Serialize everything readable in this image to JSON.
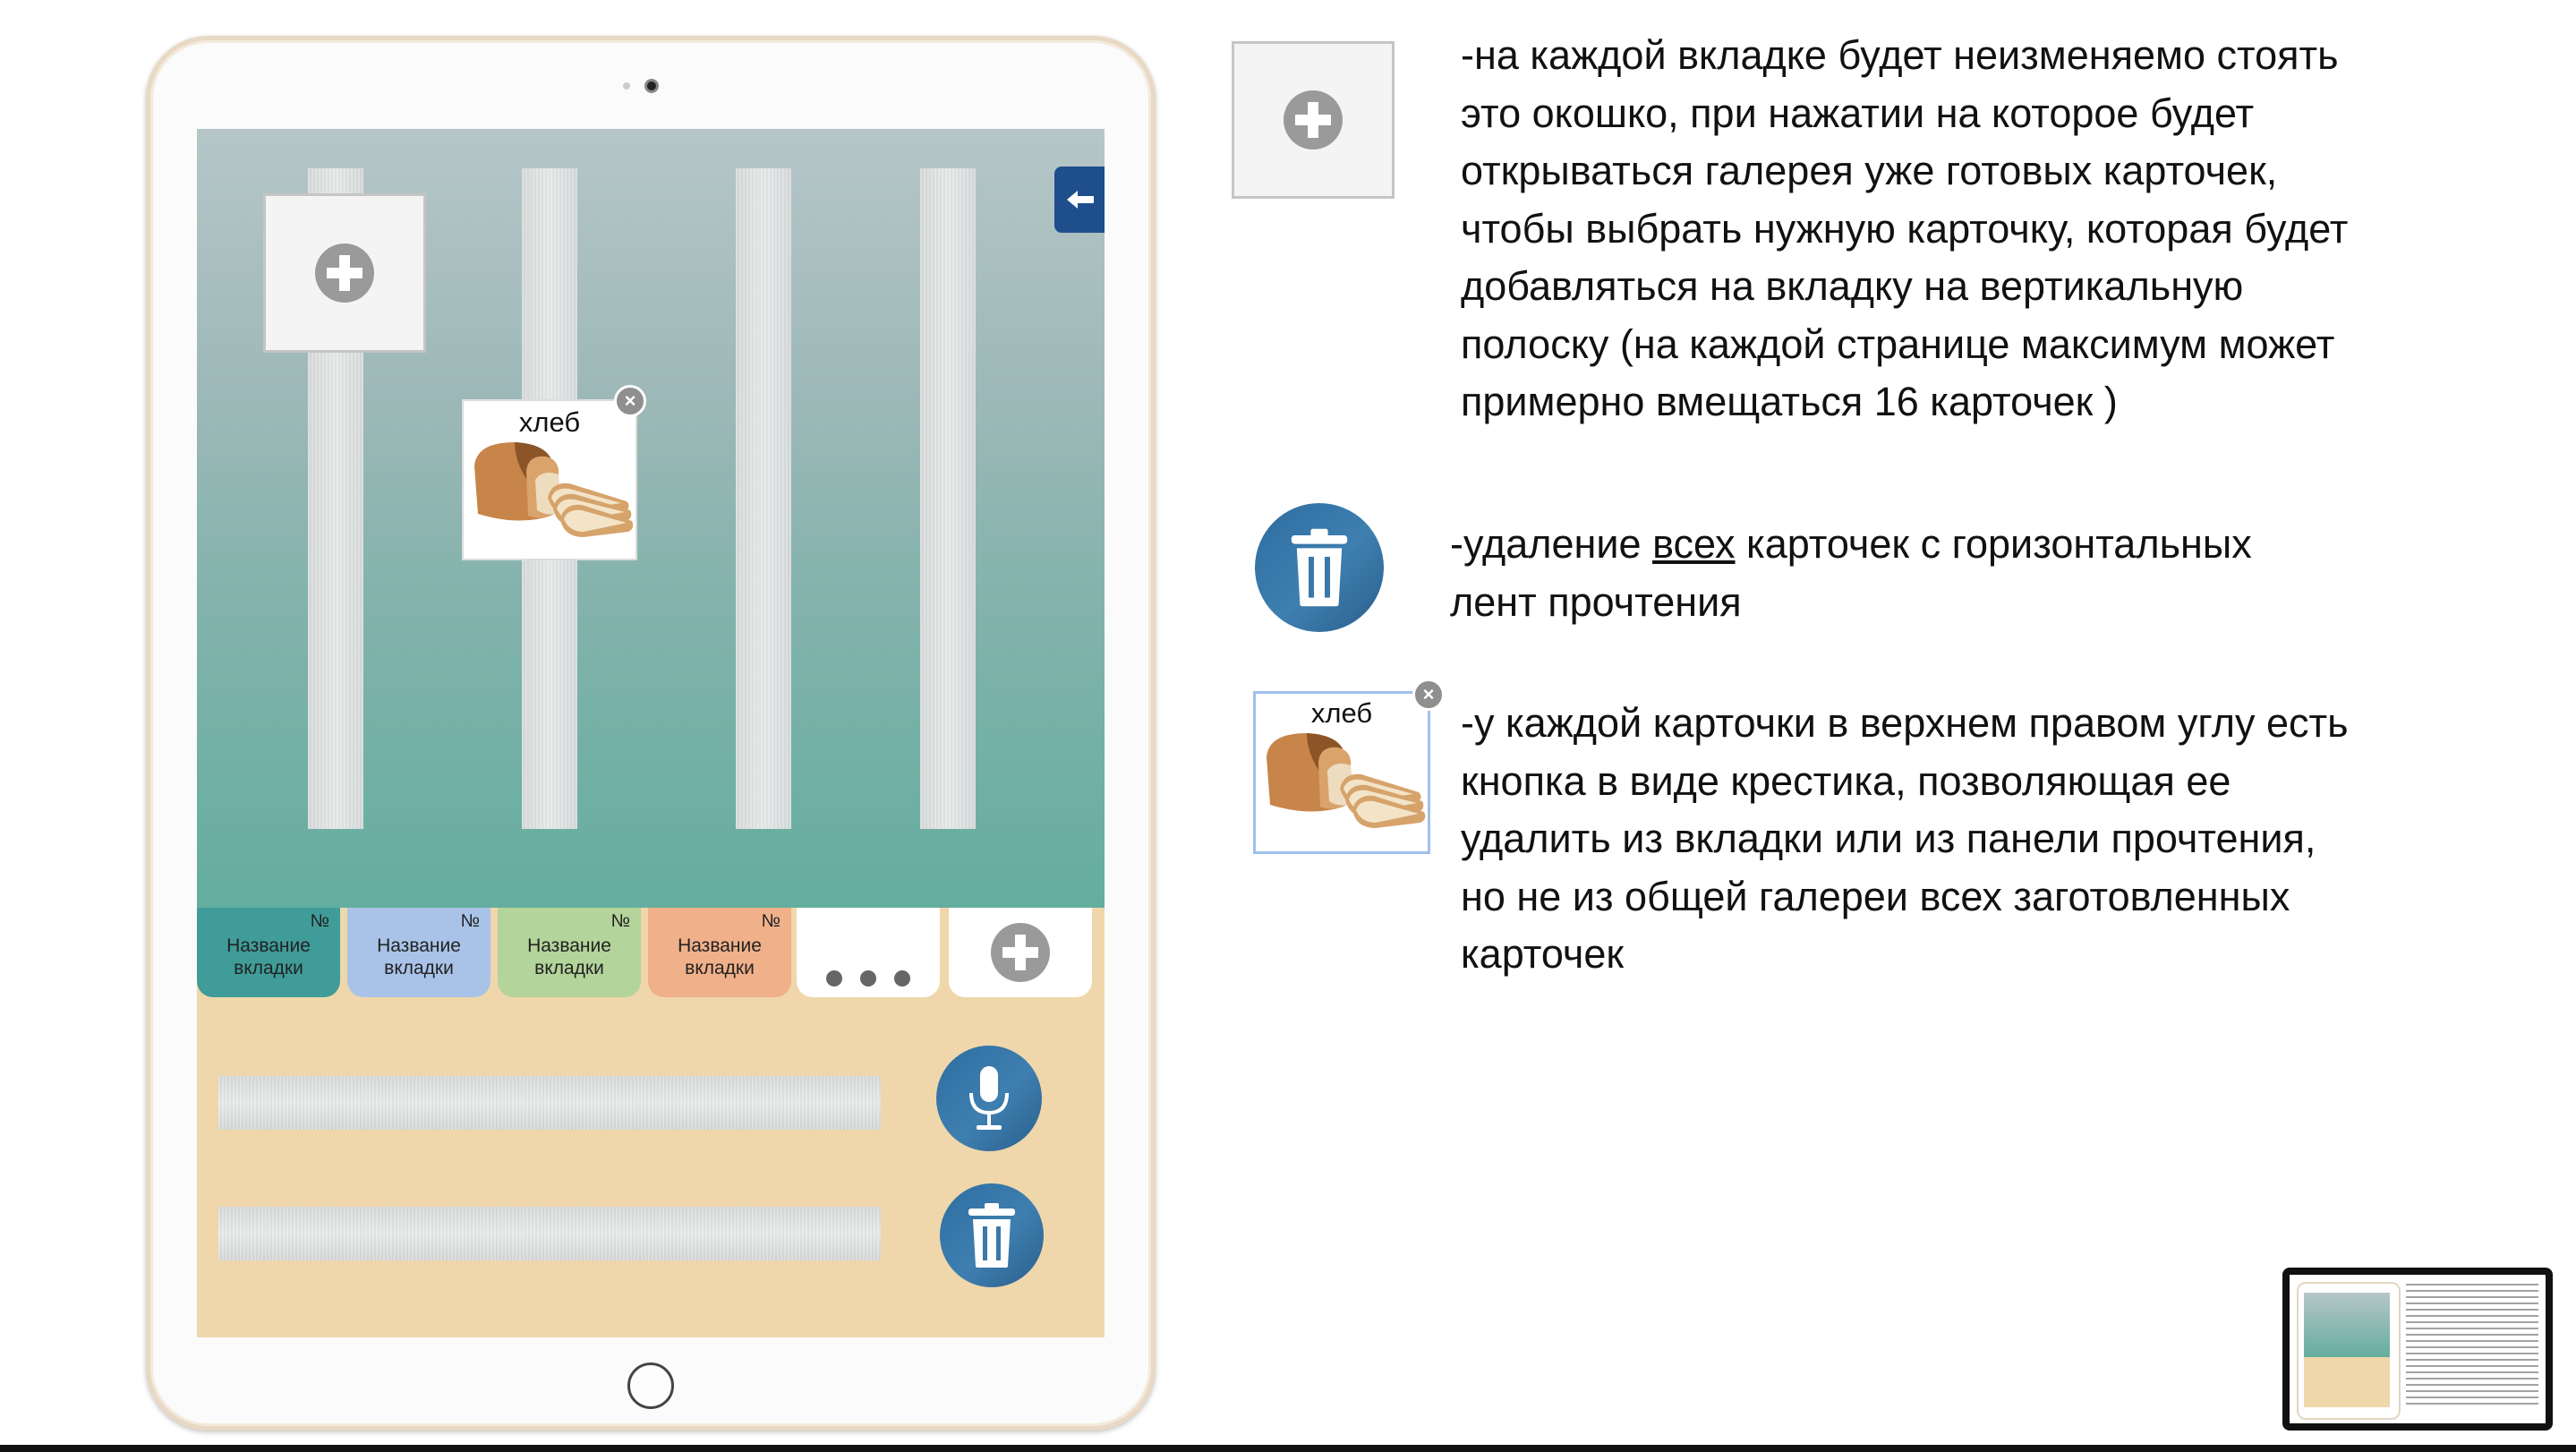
{
  "ipad": {
    "card": {
      "label": "хлеб"
    },
    "tabs": [
      {
        "name": "Название вкладки",
        "num": "№",
        "color": "#3f9c98"
      },
      {
        "name": "Название вкладки",
        "num": "№",
        "color": "#a9c3e8"
      },
      {
        "name": "Название вкладки",
        "num": "№",
        "color": "#b3d49a"
      },
      {
        "name": "Название вкладки",
        "num": "№",
        "color": "#f0b08a"
      }
    ],
    "colors": {
      "accent_blue": "#1f4e8c",
      "button_blue": "#3a78a8",
      "panel_bg": "#efd7ab"
    }
  },
  "notes": {
    "add": "-на каждой вкладке будет неизменяемо стоять это окошко, при нажатии на которое будет открываться галерея уже готовых карточек, чтобы выбрать нужную карточку, которая будет добавляться на вкладку на вертикальную полоску (на каждой странице максимум может примерно вмещаться 16 карточек )",
    "delete_prefix": "-удаление ",
    "delete_underlined": "всех",
    "delete_suffix": " карточек с горизонтальных лент прочтения",
    "card_label": "хлеб",
    "card_note": "-у каждой карточки в верхнем правом углу есть кнопка в виде крестика, позволяющая ее удалить из вкладки или из панели прочтения, но не из общей галереи всех заготовленных карточек"
  }
}
